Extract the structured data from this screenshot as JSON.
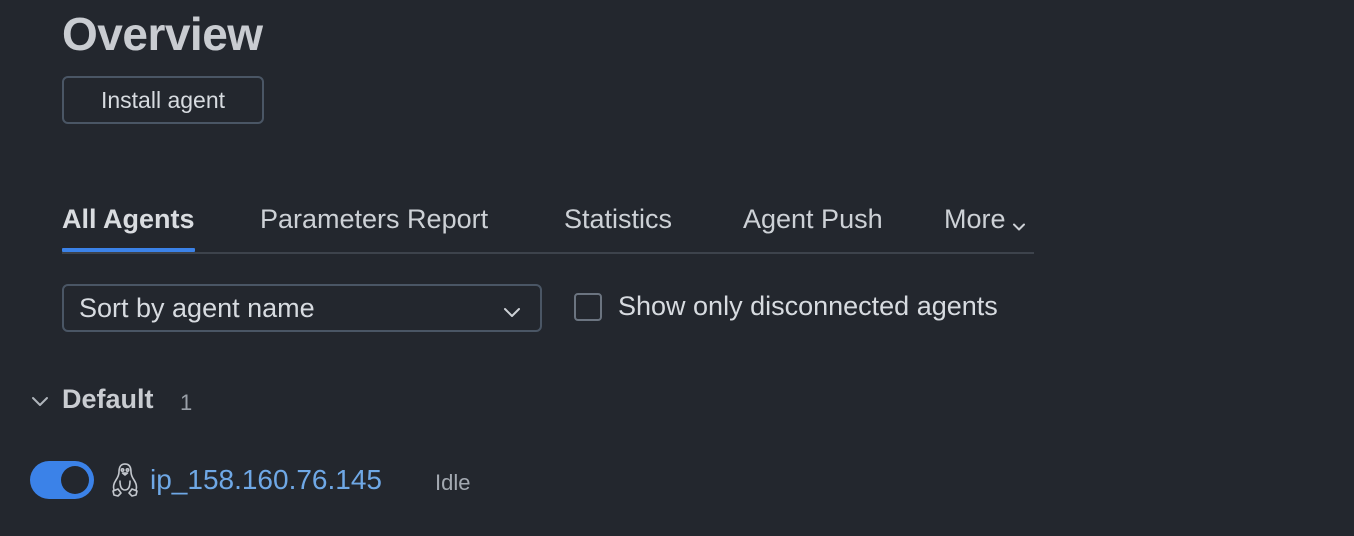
{
  "header": {
    "title": "Overview",
    "install_button_label": "Install agent"
  },
  "tabs": [
    {
      "label": "All Agents",
      "active": true
    },
    {
      "label": "Parameters Report",
      "active": false
    },
    {
      "label": "Statistics",
      "active": false
    },
    {
      "label": "Agent Push",
      "active": false
    },
    {
      "label": "More",
      "active": false,
      "icon": "chevron-down-icon"
    }
  ],
  "filters": {
    "sort_selected": "Sort by agent name",
    "disconnected_checkbox_label": "Show only disconnected agents",
    "disconnected_checked": false
  },
  "groups": [
    {
      "name": "Default",
      "count": "1",
      "expanded": true,
      "agents": [
        {
          "name": "ip_158.160.76.145",
          "status": "Idle",
          "enabled": true,
          "os_icon": "linux-penguin-icon"
        }
      ]
    }
  ],
  "colors": {
    "background": "#23272e",
    "accent": "#3b82e8",
    "link": "#6fa8e6"
  }
}
